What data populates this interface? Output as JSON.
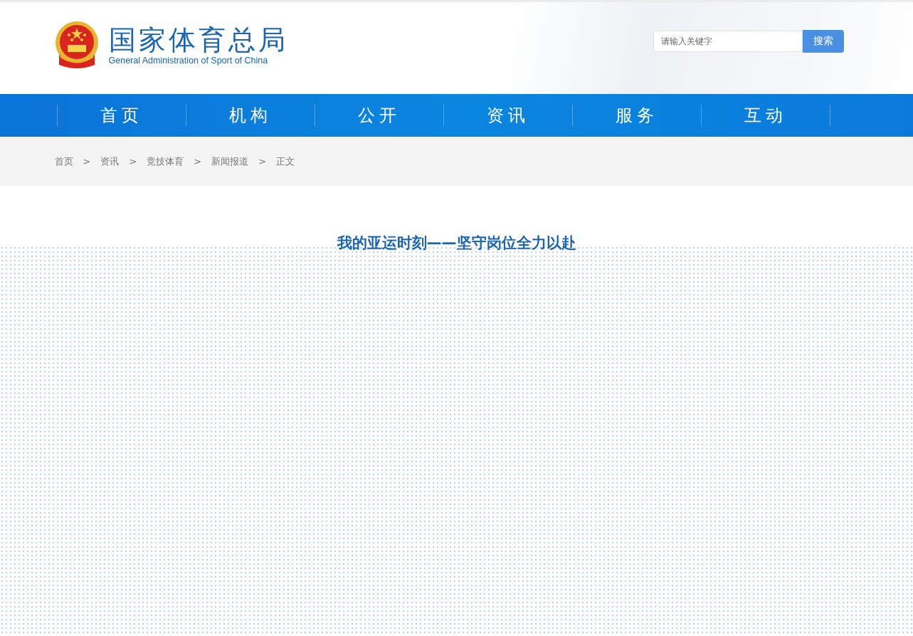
{
  "header": {
    "logo_title": "国家体育总局",
    "logo_subtitle": "General Administration of Sport of China",
    "search": {
      "placeholder": "请输入关键字",
      "button": "搜索"
    }
  },
  "nav": [
    {
      "label": "首页"
    },
    {
      "label": "机构"
    },
    {
      "label": "公开"
    },
    {
      "label": "资讯"
    },
    {
      "label": "服务"
    },
    {
      "label": "互动"
    }
  ],
  "breadcrumb": {
    "separator": ">",
    "items": [
      "首页",
      "资讯",
      "竞技体育",
      "新闻报道",
      "正文"
    ]
  },
  "article": {
    "title": "我的亚运时刻——坚守岗位全力以赴"
  }
}
